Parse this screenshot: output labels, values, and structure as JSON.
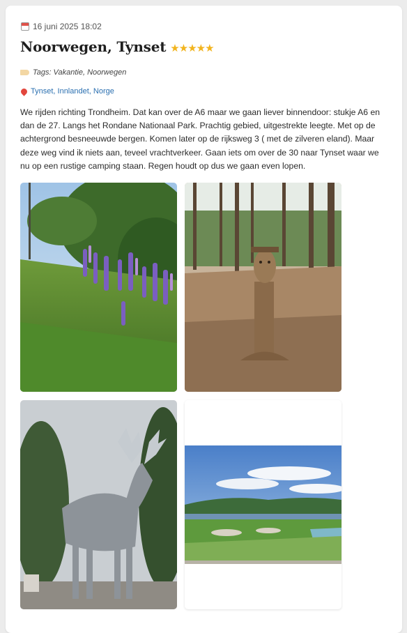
{
  "post": {
    "date": "16 juni 2025 18:02",
    "title": "Noorwegen, Tynset",
    "rating_stars": "★★★★★",
    "tags": "Tags: Vakantie, Noorwegen",
    "location": "Tynset, Innlandet, Norge",
    "body": "We rijden richting Trondheim. Dat kan over de A6 maar we gaan liever binnendoor: stukje A6 en dan de 27. Langs het Rondane Nationaal Park. Prachtig gebied, uitgestrekte leegte. Met op de achtergrond besneeuwde bergen. Komen later op de rijksweg 3 ( met de zilveren eland). Maar deze weg vind ik niets aan, teveel vrachtverkeer. Gaan iets om over de 30 naar Tynset waar we nu op een rustige camping staan. Regen houdt op dus we gaan even lopen."
  },
  "icons": {
    "date": "calendar-icon",
    "tags": "tag-icon",
    "location": "map-pin-icon"
  },
  "colors": {
    "star": "#f2b41e",
    "link": "#2a6fb0",
    "card": "#ffffff",
    "background": "#ececec"
  }
}
